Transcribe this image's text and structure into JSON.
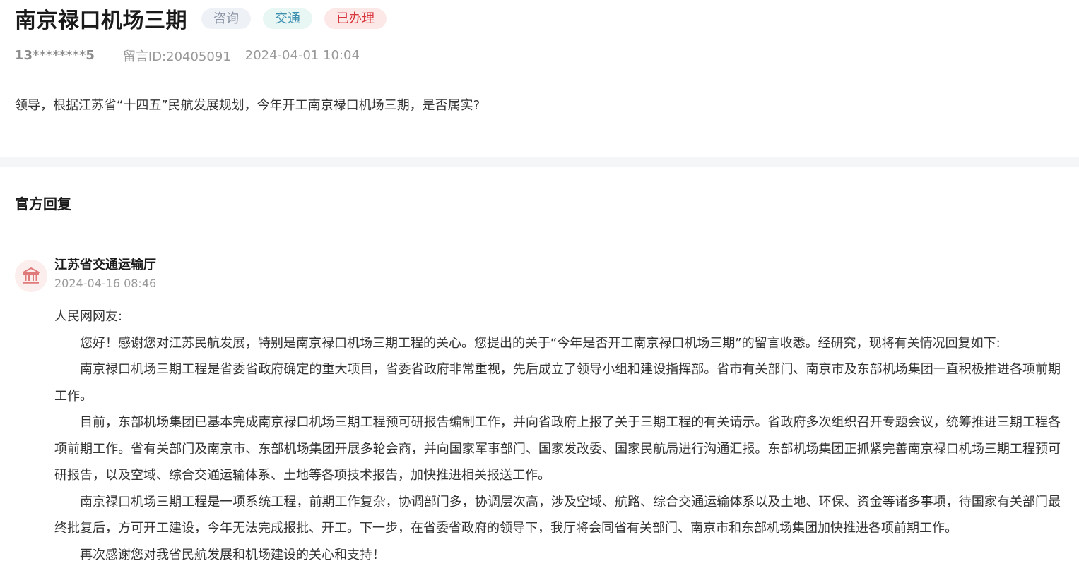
{
  "message": {
    "title": "南京禄口机场三期",
    "tags": [
      {
        "label": "咨询",
        "color": "#8a93a3"
      },
      {
        "label": "交通",
        "color": "#3d8fb0"
      },
      {
        "label": "已办理",
        "color": "#d9363e"
      }
    ],
    "user": "13********5",
    "message_id": "留言ID:20405091",
    "time": "2024-04-01 10:04",
    "body": "领导，根据江苏省“十四五”民航发展规划，今年开工南京禄口机场三期，是否属实?"
  },
  "reply": {
    "heading": "官方回复",
    "org_name": "江苏省交通运输厅",
    "org_icon": "government-building-icon",
    "time": "2024-04-16 08:46",
    "greeting": "人民网网友:",
    "paragraphs": [
      "您好！感谢您对江苏民航发展，特别是南京禄口机场三期工程的关心。您提出的关于“今年是否开工南京禄口机场三期”的留言收悉。经研究，现将有关情况回复如下:",
      "南京禄口机场三期工程是省委省政府确定的重大项目，省委省政府非常重视，先后成立了领导小组和建设指挥部。省市有关部门、南京市及东部机场集团一直积极推进各项前期工作。",
      "目前，东部机场集团已基本完成南京禄口机场三期工程预可研报告编制工作，并向省政府上报了关于三期工程的有关请示。省政府多次组织召开专题会议，统筹推进三期工程各项前期工作。省有关部门及南京市、东部机场集团开展多轮会商，并向国家军事部门、国家发改委、国家民航局进行沟通汇报。东部机场集团正抓紧完善南京禄口机场三期工程预可研报告，以及空域、综合交通运输体系、土地等各项技术报告，加快推进相关报送工作。",
      "南京禄口机场三期工程是一项系统工程，前期工作复杂，协调部门多，协调层次高，涉及空域、航路、综合交通运输体系以及土地、环保、资金等诸多事项，待国家有关部门最终批复后，方可开工建设，今年无法完成报批、开工。下一步，在省委省政府的领导下，我厅将会同省有关部门、南京市和东部机场集团加快推进各项前期工作。",
      "再次感谢您对我省民航发展和机场建设的关心和支持！"
    ]
  }
}
